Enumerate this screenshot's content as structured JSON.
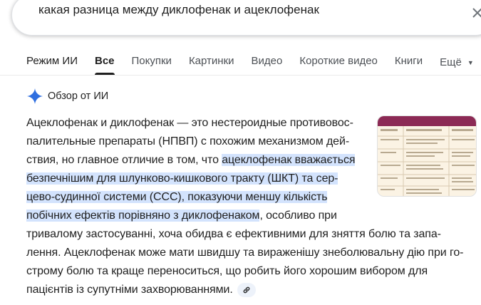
{
  "search": {
    "query": "какая разница между диклофенак и ацеклофенак"
  },
  "tabs": [
    {
      "label": "Режим ИИ"
    },
    {
      "label": "Все"
    },
    {
      "label": "Покупки"
    },
    {
      "label": "Картинки"
    },
    {
      "label": "Видео"
    },
    {
      "label": "Короткие видео"
    },
    {
      "label": "Книги"
    },
    {
      "label": "Ещё"
    }
  ],
  "ai_overview": {
    "title": "Обзор от ИИ",
    "lines": [
      "Ацеклофенак и диклофенак — это нестероидные противовос-",
      "палительные препараты (НПВП) с похожим механизмом дей-",
      "ствия, но главное отличие в том, что ",
      "ацеклофенак вважається",
      "безпечнішим для шлунково-кишкового тракту (ШКТ) та сер-",
      "цево-судинної системи (ССС), показуючи меншу кількість",
      "побічних ефектів порівняно з диклофенаком",
      ", особливо при",
      "тривалому застосуванні, хоча обидва є ефективними для зняття болю та запа-",
      "лення. Ацеклофенак може мати швидшу та вираженішу знеболювальну дію при го-",
      "строму болю та краще переноситься, що робить його хорошим вибором для",
      "пацієнтів із супутніми захворюваннями."
    ]
  },
  "colors": {
    "accent": "#1a73e8",
    "highlight": "#d3e3fd",
    "thumb_header": "#8c2a55"
  },
  "icons": {
    "clear": "close-icon",
    "sparkle": "gemini-sparkle-icon",
    "link": "link-icon",
    "more": "chevron-down-icon"
  }
}
